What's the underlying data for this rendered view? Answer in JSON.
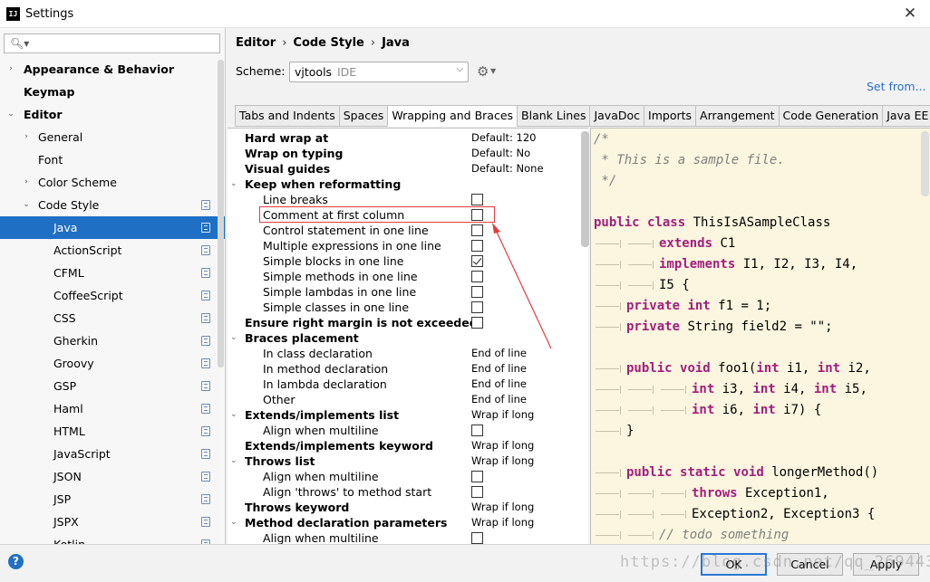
{
  "window": {
    "icon_text": "IJ",
    "title": "Settings",
    "close_glyph": "✕"
  },
  "sidebar": {
    "search_placeholder": "",
    "items": [
      {
        "label": "Appearance & Behavior",
        "level": 0,
        "arrow": "›",
        "bold": true
      },
      {
        "label": "Keymap",
        "level": 0,
        "arrow": "",
        "bold": true
      },
      {
        "label": "Editor",
        "level": 0,
        "arrow": "⌄",
        "bold": true
      },
      {
        "label": "General",
        "level": 1,
        "arrow": "›"
      },
      {
        "label": "Font",
        "level": 1,
        "arrow": ""
      },
      {
        "label": "Color Scheme",
        "level": 1,
        "arrow": "›"
      },
      {
        "label": "Code Style",
        "level": 1,
        "arrow": "⌄",
        "copy": true
      },
      {
        "label": "Java",
        "level": 2,
        "arrow": "",
        "copy": true,
        "selected": true
      },
      {
        "label": "ActionScript",
        "level": 2,
        "copy": true
      },
      {
        "label": "CFML",
        "level": 2,
        "copy": true
      },
      {
        "label": "CoffeeScript",
        "level": 2,
        "copy": true
      },
      {
        "label": "CSS",
        "level": 2,
        "copy": true
      },
      {
        "label": "Gherkin",
        "level": 2,
        "copy": true
      },
      {
        "label": "Groovy",
        "level": 2,
        "copy": true
      },
      {
        "label": "GSP",
        "level": 2,
        "copy": true
      },
      {
        "label": "Haml",
        "level": 2,
        "copy": true
      },
      {
        "label": "HTML",
        "level": 2,
        "copy": true
      },
      {
        "label": "JavaScript",
        "level": 2,
        "copy": true
      },
      {
        "label": "JSON",
        "level": 2,
        "copy": true
      },
      {
        "label": "JSP",
        "level": 2,
        "copy": true
      },
      {
        "label": "JSPX",
        "level": 2,
        "copy": true
      },
      {
        "label": "Kotlin",
        "level": 2,
        "copy": true
      }
    ]
  },
  "breadcrumb": [
    "Editor",
    "Code Style",
    "Java"
  ],
  "breadcrumb_sep": "›",
  "scheme": {
    "label": "Scheme:",
    "value": "vjtools",
    "tag": "IDE"
  },
  "set_from": "Set from...",
  "tabs": [
    "Tabs and Indents",
    "Spaces",
    "Wrapping and Braces",
    "Blank Lines",
    "JavaDoc",
    "Imports",
    "Arrangement",
    "Code Generation",
    "Java EE Names"
  ],
  "active_tab": 2,
  "options": [
    {
      "label": "Hard wrap at",
      "bold": true,
      "value": "Default: 120"
    },
    {
      "label": "Wrap on typing",
      "bold": true,
      "value": "Default: No"
    },
    {
      "label": "Visual guides",
      "bold": true,
      "value": "Default: None"
    },
    {
      "label": "Keep when reformatting",
      "bold": true,
      "arrow": "⌄"
    },
    {
      "label": "Line breaks",
      "indent": true,
      "checkbox": false
    },
    {
      "label": "Comment at first column",
      "indent": true,
      "checkbox": false
    },
    {
      "label": "Control statement in one line",
      "indent": true,
      "checkbox": false
    },
    {
      "label": "Multiple expressions in one line",
      "indent": true,
      "checkbox": false
    },
    {
      "label": "Simple blocks in one line",
      "indent": true,
      "checkbox": true
    },
    {
      "label": "Simple methods in one line",
      "indent": true,
      "checkbox": false
    },
    {
      "label": "Simple lambdas in one line",
      "indent": true,
      "checkbox": false
    },
    {
      "label": "Simple classes in one line",
      "indent": true,
      "checkbox": false
    },
    {
      "label": "Ensure right margin is not exceeded",
      "bold": true,
      "checkbox": false
    },
    {
      "label": "Braces placement",
      "bold": true,
      "arrow": "⌄"
    },
    {
      "label": "In class declaration",
      "indent": true,
      "value": "End of line"
    },
    {
      "label": "In method declaration",
      "indent": true,
      "value": "End of line"
    },
    {
      "label": "In lambda declaration",
      "indent": true,
      "value": "End of line"
    },
    {
      "label": "Other",
      "indent": true,
      "value": "End of line"
    },
    {
      "label": "Extends/implements list",
      "bold": true,
      "arrow": "⌄",
      "value": "Wrap if long"
    },
    {
      "label": "Align when multiline",
      "indent": true,
      "checkbox": false
    },
    {
      "label": "Extends/implements keyword",
      "bold": true,
      "value": "Wrap if long"
    },
    {
      "label": "Throws list",
      "bold": true,
      "arrow": "⌄",
      "value": "Wrap if long"
    },
    {
      "label": "Align when multiline",
      "indent": true,
      "checkbox": false
    },
    {
      "label": "Align 'throws' to method start",
      "indent": true,
      "checkbox": false
    },
    {
      "label": "Throws keyword",
      "bold": true,
      "value": "Wrap if long"
    },
    {
      "label": "Method declaration parameters",
      "bold": true,
      "arrow": "⌄",
      "value": "Wrap if long"
    },
    {
      "label": "Align when multiline",
      "indent": true,
      "checkbox": false
    }
  ],
  "preview_lines": [
    [
      {
        "t": "/*",
        "c": "cm"
      }
    ],
    [
      {
        "t": " * This is a sample file.",
        "c": "cm"
      }
    ],
    [
      {
        "t": " */",
        "c": "cm"
      }
    ],
    [],
    [
      {
        "t": "public ",
        "c": "kw"
      },
      {
        "t": "class ",
        "c": "kw"
      },
      {
        "t": "ThisIsASampleClass",
        "c": "tx"
      }
    ],
    [
      {
        "tab": 2
      },
      {
        "t": "extends ",
        "c": "kw"
      },
      {
        "t": "C1",
        "c": "tx"
      }
    ],
    [
      {
        "tab": 2
      },
      {
        "t": "implements ",
        "c": "kw"
      },
      {
        "t": "I1, I2, I3, I4,",
        "c": "tx"
      }
    ],
    [
      {
        "tab": 2
      },
      {
        "t": "I5 {",
        "c": "tx"
      }
    ],
    [
      {
        "tab": 1
      },
      {
        "t": "private ",
        "c": "kw"
      },
      {
        "t": "int ",
        "c": "kw"
      },
      {
        "t": "f1 = 1;",
        "c": "tx"
      }
    ],
    [
      {
        "tab": 1
      },
      {
        "t": "private ",
        "c": "kw"
      },
      {
        "t": "String field2 = \"\";",
        "c": "tx"
      }
    ],
    [],
    [
      {
        "tab": 1
      },
      {
        "t": "public ",
        "c": "kw"
      },
      {
        "t": "void ",
        "c": "kw"
      },
      {
        "t": "foo1(",
        "c": "tx"
      },
      {
        "t": "int ",
        "c": "kw"
      },
      {
        "t": "i1, ",
        "c": "tx"
      },
      {
        "t": "int ",
        "c": "kw"
      },
      {
        "t": "i2,",
        "c": "tx"
      }
    ],
    [
      {
        "tab": 3
      },
      {
        "t": "int ",
        "c": "kw"
      },
      {
        "t": "i3, ",
        "c": "tx"
      },
      {
        "t": "int ",
        "c": "kw"
      },
      {
        "t": "i4, ",
        "c": "tx"
      },
      {
        "t": "int ",
        "c": "kw"
      },
      {
        "t": "i5,",
        "c": "tx"
      }
    ],
    [
      {
        "tab": 3
      },
      {
        "t": "int ",
        "c": "kw"
      },
      {
        "t": "i6, ",
        "c": "tx"
      },
      {
        "t": "int ",
        "c": "kw"
      },
      {
        "t": "i7) {",
        "c": "tx"
      }
    ],
    [
      {
        "tab": 1
      },
      {
        "t": "}",
        "c": "tx"
      }
    ],
    [],
    [
      {
        "tab": 1
      },
      {
        "t": "public ",
        "c": "kw"
      },
      {
        "t": "static ",
        "c": "kw"
      },
      {
        "t": "void ",
        "c": "kw"
      },
      {
        "t": "longerMethod()",
        "c": "tx"
      }
    ],
    [
      {
        "tab": 3
      },
      {
        "t": "throws ",
        "c": "kw"
      },
      {
        "t": "Exception1,",
        "c": "tx"
      }
    ],
    [
      {
        "tab": 3
      },
      {
        "t": "Exception2, Exception3 {",
        "c": "tx"
      }
    ],
    [
      {
        "tab": 2
      },
      {
        "t": "// todo something",
        "c": "cm"
      }
    ]
  ],
  "buttons": {
    "ok": "OK",
    "cancel": "Cancel",
    "apply": "Apply"
  },
  "help": "?",
  "watermark": "https://blog.csdn.net/qq_2694433",
  "colors": {
    "accent": "#1f6fc5",
    "annotation": "#e23d3d",
    "keyword": "#a01f7d",
    "preview_bg": "#fcf5df"
  }
}
